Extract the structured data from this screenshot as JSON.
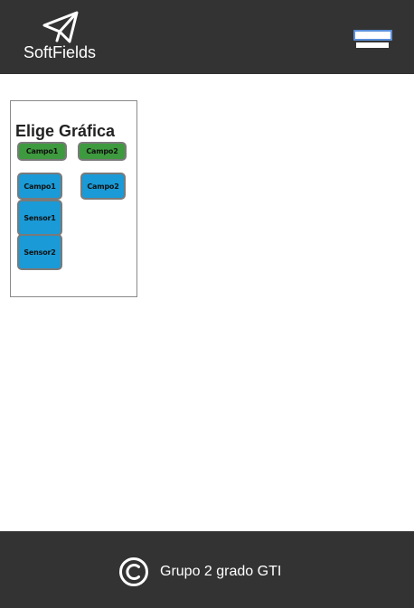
{
  "header": {
    "brand": "SoftFields",
    "logo_icon": "paper-plane-icon",
    "menu_icon": "hamburger-menu-icon"
  },
  "chart_selector": {
    "title": "Elige Gráfica",
    "buttons": [
      {
        "label": "Campo1",
        "color": "#3e9a3e"
      },
      {
        "label": "Campo2",
        "color": "#3e9a3e"
      },
      {
        "label": "Campo1",
        "color": "#1a9ad6"
      },
      {
        "label": "Campo2",
        "color": "#1a9ad6"
      },
      {
        "label": "Sensor1",
        "color": "#1a9ad6"
      },
      {
        "label": "Sensor2",
        "color": "#1a9ad6"
      }
    ]
  },
  "footer": {
    "copyright_icon": "copyright-icon",
    "text": "Grupo 2 grado GTI"
  },
  "colors": {
    "header_bg": "#333333",
    "footer_bg": "#333333",
    "green": "#3e9a3e",
    "blue": "#1a9ad6"
  }
}
